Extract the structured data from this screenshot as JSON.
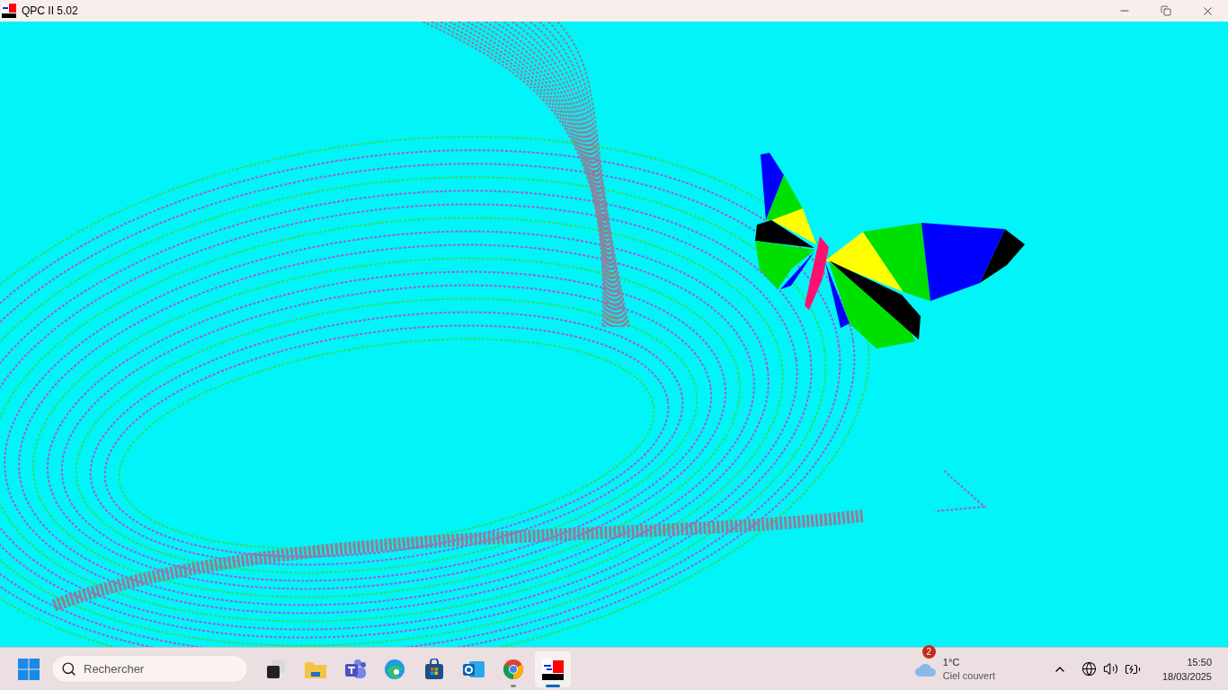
{
  "window": {
    "title": "QPC II 5.02"
  },
  "taskbar": {
    "search": {
      "placeholder": "Rechercher"
    },
    "apps": [
      {
        "kind": "taskview",
        "running": false,
        "selected": false
      },
      {
        "kind": "folder",
        "running": false,
        "selected": false
      },
      {
        "kind": "teams",
        "running": false,
        "selected": false
      },
      {
        "kind": "edge",
        "running": false,
        "selected": false
      },
      {
        "kind": "store",
        "running": false,
        "selected": false
      },
      {
        "kind": "outlook",
        "running": false,
        "selected": false
      },
      {
        "kind": "chrome",
        "running": true,
        "selected": false
      },
      {
        "kind": "qpc",
        "running": true,
        "selected": true
      }
    ],
    "weather": {
      "badge": "2",
      "temperature": "1°C",
      "condition": "Ciel couvert"
    },
    "clock": {
      "time": "15:50",
      "date": "18/03/2025"
    }
  }
}
